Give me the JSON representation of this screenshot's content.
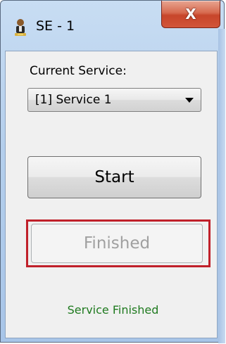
{
  "window": {
    "title": "SE - 1",
    "close_label": "X",
    "app_icon": "service-person-icon"
  },
  "form": {
    "current_service_label": "Current Service:",
    "service_select": {
      "selected": "[1] Service 1",
      "dropdown_icon": "chevron-down-icon"
    },
    "start_label": "Start",
    "finished_label": "Finished",
    "finished_enabled": false,
    "status_text": "Service Finished"
  },
  "colors": {
    "status_text": "#1f7a1f",
    "highlight_border": "#c0202a",
    "close_button": "#c7452a",
    "titlebar": "#b5cfec",
    "disabled_text": "#a0a0a0"
  }
}
